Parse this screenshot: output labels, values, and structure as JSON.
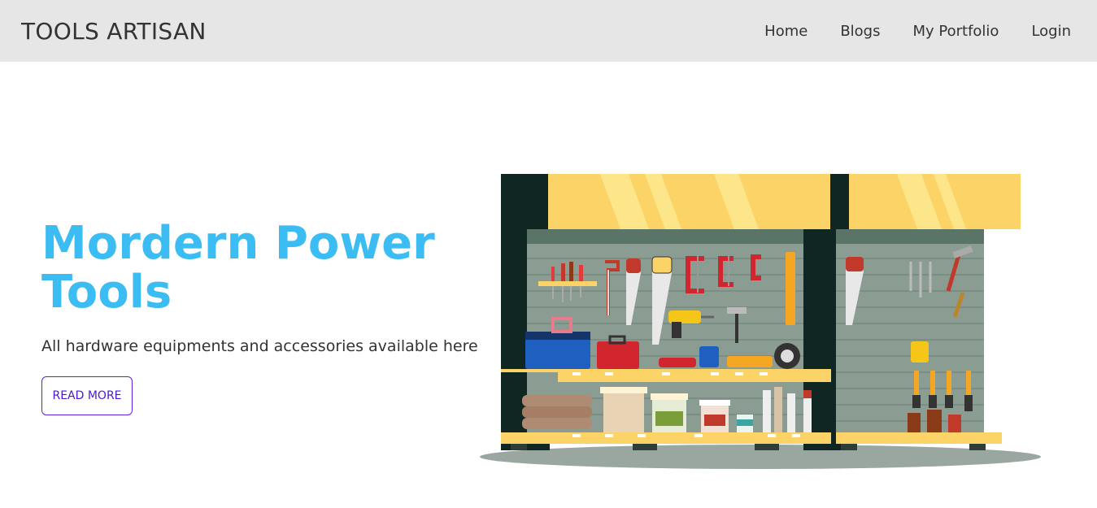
{
  "navbar": {
    "brand": "TOOLS ARTISAN",
    "links": [
      {
        "label": "Home"
      },
      {
        "label": "Blogs"
      },
      {
        "label": "My Portfolio"
      },
      {
        "label": "Login"
      }
    ]
  },
  "hero": {
    "title": "Mordern Power Tools",
    "subtitle": "All hardware equipments and accessories available here",
    "button_label": "READ MORE"
  },
  "colors": {
    "navbar_bg": "#e6e6e6",
    "title": "#3bbcf2",
    "button_border": "#5d1eeb",
    "awning": "#fcd367",
    "panel": "#8b9d92",
    "frame": "#0f2623"
  },
  "illustration": {
    "name": "hardware-store-shelf-illustration"
  }
}
